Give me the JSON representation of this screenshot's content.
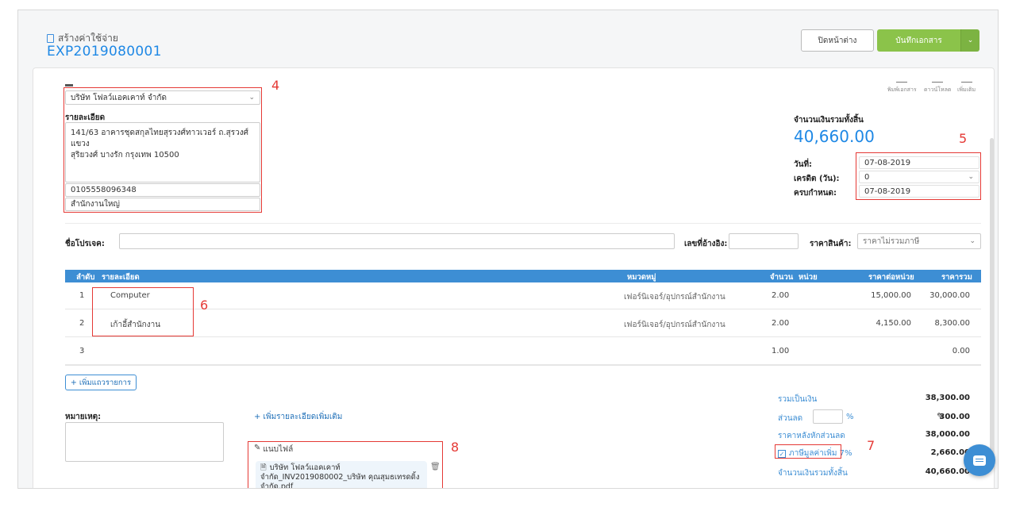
{
  "header": {
    "doc_type": "สร้างค่าใช้จ่าย",
    "doc_code": "EXP2019080001",
    "close_label": "ปิดหน้าต่าง",
    "save_label": "บันทึกเอกสาร",
    "save_dropdown": "⌄"
  },
  "contact": {
    "company": "บริษัท โฟลว์แอคเคาท์ จำกัด",
    "detail_label": "รายละเอียด",
    "address_line1": "141/63 อาคารชุดสกุลไทยสุรวงศ์ทาวเวอร์ ถ.สุรวงศ์ แขวง",
    "address_line2": "สุริยวงศ์ บางรัก กรุงเทพ 10500",
    "tax_id": "0105558096348",
    "branch": "สำนักงานใหญ่",
    "annotation": "4"
  },
  "tools": {
    "print": "พิมพ์เอกสาร",
    "download": "ดาวน์โหลด",
    "more": "เพิ่มเติม"
  },
  "totals_top": {
    "label": "จำนวนเงินรวมทั้งสิ้น",
    "amount": "40,660.00",
    "annotation": "5",
    "date_label": "วันที่:",
    "date_value": "07-08-2019",
    "credit_label": "เครดิต (วัน):",
    "credit_value": "0",
    "due_label": "ครบกำหนด:",
    "due_value": "07-08-2019"
  },
  "meta": {
    "project_label": "ชื่อโปรเจค:",
    "project_value": "",
    "ref_label": "เลขที่อ้างอิง:",
    "ref_value": "",
    "price_label": "ราคาสินค้า:",
    "price_value": "ราคาไม่รวมภาษี"
  },
  "table": {
    "headers": {
      "no": "ลำดับ",
      "detail": "รายละเอียด",
      "category": "หมวดหมู่",
      "qty": "จำนวน",
      "unit": "หน่วย",
      "unit_price": "ราคาต่อหน่วย",
      "total": "ราคารวม"
    },
    "rows": [
      {
        "no": "1",
        "detail": "Computer",
        "category": "เฟอร์นิเจอร์/อุปกรณ์สำนักงาน",
        "qty": "2.00",
        "unit_price": "15,000.00",
        "total": "30,000.00"
      },
      {
        "no": "2",
        "detail": "เก้าอี้สำนักงาน",
        "category": "เฟอร์นิเจอร์/อุปกรณ์สำนักงาน",
        "qty": "2.00",
        "unit_price": "4,150.00",
        "total": "8,300.00"
      },
      {
        "no": "3",
        "detail": "",
        "category": "",
        "qty": "1.00",
        "unit_price": "",
        "total": "0.00"
      }
    ],
    "annotation": "6",
    "add_row": "+ เพิ่มแถวรายการ"
  },
  "notes": {
    "label": "หมายเหตุ:",
    "add_detail": "+ เพิ่มรายละเอียดเพิ่มเติม",
    "attach_label": "แนบไฟล์",
    "file_line1": "บริษัท โฟลว์แอคเคาท์",
    "file_line2": "จำกัด_INV2019080002_บริษัท คุณสุมธเทรดดิ้ง",
    "file_line3": "จำกัด.pdf",
    "annotation": "8"
  },
  "summary": {
    "subtotal_label": "รวมเป็นเงิน",
    "subtotal": "38,300.00",
    "discount_label": "ส่วนลด",
    "discount_unit": "%",
    "discount": "300.00",
    "after_discount_label": "ราคาหลังหักส่วนลด",
    "after_discount": "38,000.00",
    "vat_label": "ภาษีมูลค่าเพิ่ม 7%",
    "vat": "2,660.00",
    "grand_label": "จำนวนเงินรวมทั้งสิ้น",
    "grand": "40,660.00",
    "annotation": "7"
  },
  "colors": {
    "accent": "#3d8ed4",
    "save": "#8bc34a",
    "annotation": "#e53935"
  }
}
